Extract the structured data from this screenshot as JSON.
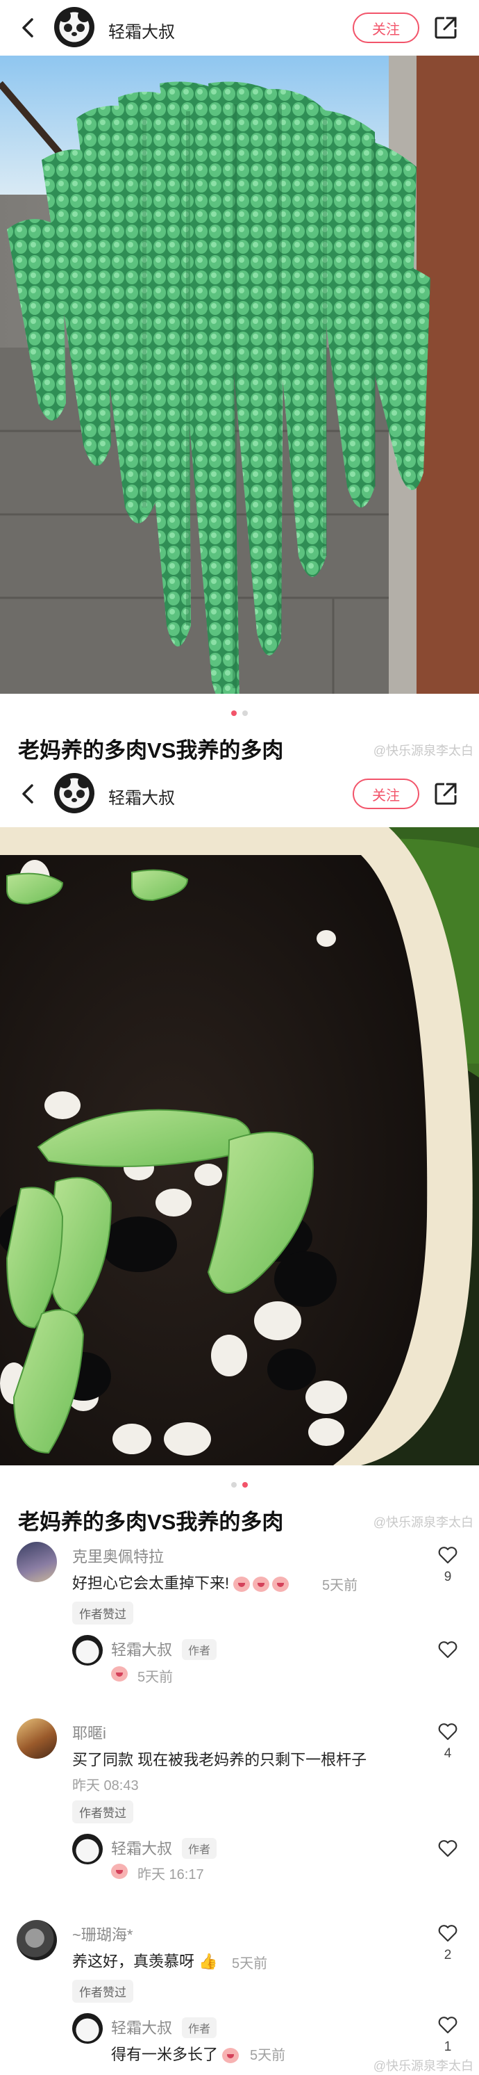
{
  "screen1": {
    "header": {
      "author": "轻霜大叔",
      "follow_label": "关注"
    },
    "carousel": {
      "count": 2,
      "active": 1
    },
    "title": "老妈养的多肉VS我养的多肉",
    "watermark": "@快乐源泉李太白"
  },
  "screen2": {
    "header": {
      "author": "轻霜大叔",
      "follow_label": "关注"
    },
    "carousel": {
      "count": 2,
      "active": 2
    },
    "title": "老妈养的多肉VS我养的多肉",
    "watermark": "@快乐源泉李太白"
  },
  "comments": [
    {
      "name": "克里奥佩特拉",
      "text": "好担心它会太重掉下来!",
      "time": "5天前",
      "badge": "作者赞过",
      "likes": "9",
      "reply": {
        "name": "轻霜大叔",
        "tag": "作者",
        "text": "",
        "time": "5天前",
        "likes": ""
      }
    },
    {
      "name": "耶暱i",
      "text": "买了同款 现在被我老妈养的只剩下一根杆子",
      "time": "昨天 08:43",
      "badge": "作者赞过",
      "likes": "4",
      "reply": {
        "name": "轻霜大叔",
        "tag": "作者",
        "text": "",
        "time": "昨天 16:17",
        "likes": ""
      }
    },
    {
      "name": "~珊瑚海*",
      "text": "养这好，真羡慕呀",
      "time": "5天前",
      "badge": "作者赞过",
      "likes": "2",
      "reply": {
        "name": "轻霜大叔",
        "tag": "作者",
        "text": "得有一米多长了",
        "time": "5天前",
        "likes": "1"
      }
    }
  ],
  "footer_watermark": "@快乐源泉李太白",
  "colors": {
    "accent": "#f2546a",
    "succulent_green": "#3fae6a"
  }
}
